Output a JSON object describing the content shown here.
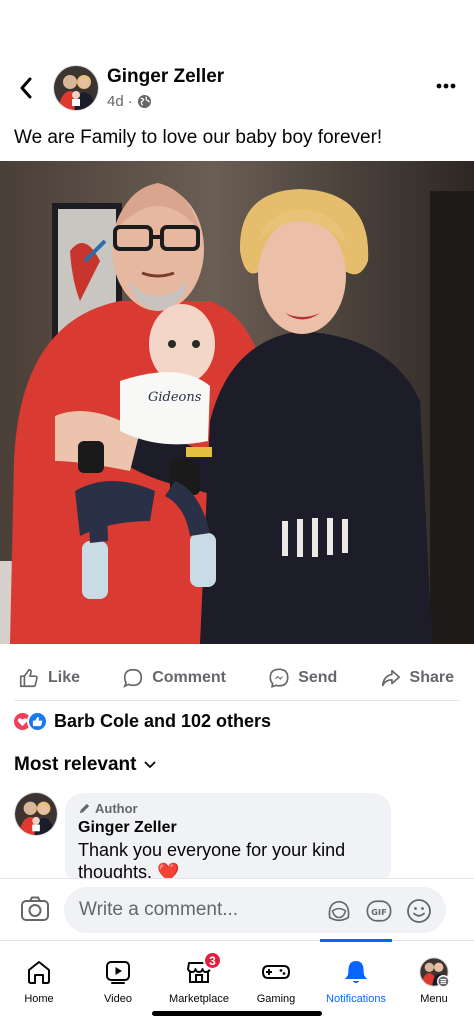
{
  "post": {
    "author": "Ginger Zeller",
    "time": "4d",
    "separator": "·",
    "caption": "We are Family to love our baby boy forever!"
  },
  "actions": {
    "like": "Like",
    "comment": "Comment",
    "send": "Send",
    "share": "Share"
  },
  "reactions": {
    "summary": "Barb Cole and 102 others",
    "icons": [
      "love-icon",
      "like-icon"
    ]
  },
  "comments": {
    "sort_label": "Most relevant",
    "items": [
      {
        "badge": "Author",
        "name": "Ginger Zeller",
        "text": "Thank you everyone for your kind thoughts. ❤️"
      }
    ]
  },
  "composer": {
    "placeholder": "Write a comment..."
  },
  "tabs": [
    {
      "label": "Home",
      "icon": "home-icon"
    },
    {
      "label": "Video",
      "icon": "video-icon"
    },
    {
      "label": "Marketplace",
      "icon": "marketplace-icon",
      "badge": "3"
    },
    {
      "label": "Gaming",
      "icon": "gaming-icon"
    },
    {
      "label": "Notifications",
      "icon": "bell-icon",
      "active": true
    },
    {
      "label": "Menu",
      "icon": "avatar-menu-icon"
    }
  ],
  "colors": {
    "accent": "#0866ff",
    "like_blue": "#1877f2",
    "love_red": "#f33e58",
    "badge_red": "#e41e3f",
    "secondary_text": "#65676b"
  }
}
